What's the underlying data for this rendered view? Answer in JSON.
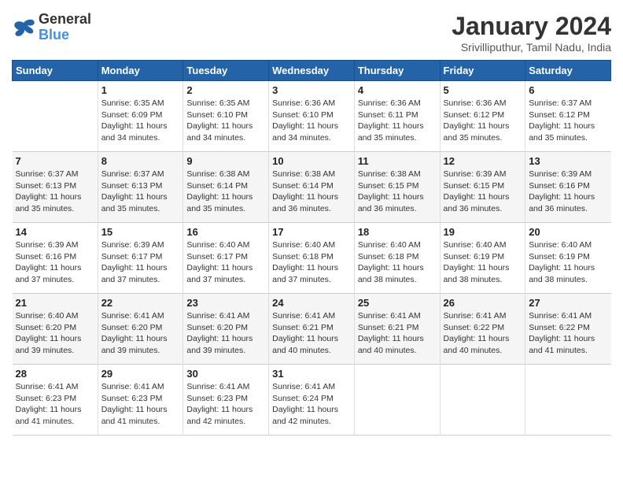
{
  "logo": {
    "line1": "General",
    "line2": "Blue"
  },
  "title": "January 2024",
  "location": "Srivilliputhur, Tamil Nadu, India",
  "days_of_week": [
    "Sunday",
    "Monday",
    "Tuesday",
    "Wednesday",
    "Thursday",
    "Friday",
    "Saturday"
  ],
  "weeks": [
    [
      {
        "day": "",
        "info": ""
      },
      {
        "day": "1",
        "info": "Sunrise: 6:35 AM\nSunset: 6:09 PM\nDaylight: 11 hours\nand 34 minutes."
      },
      {
        "day": "2",
        "info": "Sunrise: 6:35 AM\nSunset: 6:10 PM\nDaylight: 11 hours\nand 34 minutes."
      },
      {
        "day": "3",
        "info": "Sunrise: 6:36 AM\nSunset: 6:10 PM\nDaylight: 11 hours\nand 34 minutes."
      },
      {
        "day": "4",
        "info": "Sunrise: 6:36 AM\nSunset: 6:11 PM\nDaylight: 11 hours\nand 35 minutes."
      },
      {
        "day": "5",
        "info": "Sunrise: 6:36 AM\nSunset: 6:12 PM\nDaylight: 11 hours\nand 35 minutes."
      },
      {
        "day": "6",
        "info": "Sunrise: 6:37 AM\nSunset: 6:12 PM\nDaylight: 11 hours\nand 35 minutes."
      }
    ],
    [
      {
        "day": "7",
        "info": "Sunrise: 6:37 AM\nSunset: 6:13 PM\nDaylight: 11 hours\nand 35 minutes."
      },
      {
        "day": "8",
        "info": "Sunrise: 6:37 AM\nSunset: 6:13 PM\nDaylight: 11 hours\nand 35 minutes."
      },
      {
        "day": "9",
        "info": "Sunrise: 6:38 AM\nSunset: 6:14 PM\nDaylight: 11 hours\nand 35 minutes."
      },
      {
        "day": "10",
        "info": "Sunrise: 6:38 AM\nSunset: 6:14 PM\nDaylight: 11 hours\nand 36 minutes."
      },
      {
        "day": "11",
        "info": "Sunrise: 6:38 AM\nSunset: 6:15 PM\nDaylight: 11 hours\nand 36 minutes."
      },
      {
        "day": "12",
        "info": "Sunrise: 6:39 AM\nSunset: 6:15 PM\nDaylight: 11 hours\nand 36 minutes."
      },
      {
        "day": "13",
        "info": "Sunrise: 6:39 AM\nSunset: 6:16 PM\nDaylight: 11 hours\nand 36 minutes."
      }
    ],
    [
      {
        "day": "14",
        "info": "Sunrise: 6:39 AM\nSunset: 6:16 PM\nDaylight: 11 hours\nand 37 minutes."
      },
      {
        "day": "15",
        "info": "Sunrise: 6:39 AM\nSunset: 6:17 PM\nDaylight: 11 hours\nand 37 minutes."
      },
      {
        "day": "16",
        "info": "Sunrise: 6:40 AM\nSunset: 6:17 PM\nDaylight: 11 hours\nand 37 minutes."
      },
      {
        "day": "17",
        "info": "Sunrise: 6:40 AM\nSunset: 6:18 PM\nDaylight: 11 hours\nand 37 minutes."
      },
      {
        "day": "18",
        "info": "Sunrise: 6:40 AM\nSunset: 6:18 PM\nDaylight: 11 hours\nand 38 minutes."
      },
      {
        "day": "19",
        "info": "Sunrise: 6:40 AM\nSunset: 6:19 PM\nDaylight: 11 hours\nand 38 minutes."
      },
      {
        "day": "20",
        "info": "Sunrise: 6:40 AM\nSunset: 6:19 PM\nDaylight: 11 hours\nand 38 minutes."
      }
    ],
    [
      {
        "day": "21",
        "info": "Sunrise: 6:40 AM\nSunset: 6:20 PM\nDaylight: 11 hours\nand 39 minutes."
      },
      {
        "day": "22",
        "info": "Sunrise: 6:41 AM\nSunset: 6:20 PM\nDaylight: 11 hours\nand 39 minutes."
      },
      {
        "day": "23",
        "info": "Sunrise: 6:41 AM\nSunset: 6:20 PM\nDaylight: 11 hours\nand 39 minutes."
      },
      {
        "day": "24",
        "info": "Sunrise: 6:41 AM\nSunset: 6:21 PM\nDaylight: 11 hours\nand 40 minutes."
      },
      {
        "day": "25",
        "info": "Sunrise: 6:41 AM\nSunset: 6:21 PM\nDaylight: 11 hours\nand 40 minutes."
      },
      {
        "day": "26",
        "info": "Sunrise: 6:41 AM\nSunset: 6:22 PM\nDaylight: 11 hours\nand 40 minutes."
      },
      {
        "day": "27",
        "info": "Sunrise: 6:41 AM\nSunset: 6:22 PM\nDaylight: 11 hours\nand 41 minutes."
      }
    ],
    [
      {
        "day": "28",
        "info": "Sunrise: 6:41 AM\nSunset: 6:23 PM\nDaylight: 11 hours\nand 41 minutes."
      },
      {
        "day": "29",
        "info": "Sunrise: 6:41 AM\nSunset: 6:23 PM\nDaylight: 11 hours\nand 41 minutes."
      },
      {
        "day": "30",
        "info": "Sunrise: 6:41 AM\nSunset: 6:23 PM\nDaylight: 11 hours\nand 42 minutes."
      },
      {
        "day": "31",
        "info": "Sunrise: 6:41 AM\nSunset: 6:24 PM\nDaylight: 11 hours\nand 42 minutes."
      },
      {
        "day": "",
        "info": ""
      },
      {
        "day": "",
        "info": ""
      },
      {
        "day": "",
        "info": ""
      }
    ]
  ]
}
